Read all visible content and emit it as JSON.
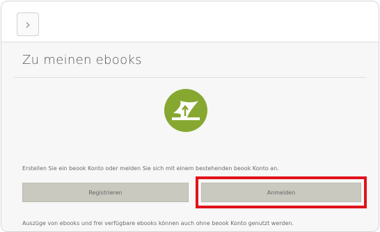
{
  "nav": {
    "back_icon": "chevron-right-icon",
    "back_glyph": "›"
  },
  "page": {
    "title": "Zu meinen ebooks",
    "logo_icon": "road-arrow-icon",
    "intro_text": "Erstellen Sie ein beook Konto oder melden Sie sich mit einem bestehenden beook Konto an.",
    "footer_text": "Auszüge von ebooks und frei verfügbare ebooks können auch ohne beook Konto genutzt werden."
  },
  "buttons": {
    "register_label": "Registrieren",
    "login_label": "Anmelden"
  },
  "colors": {
    "logo_green": "#86a830",
    "highlight_red": "#e0131c",
    "button_gray": "#c9c9c0"
  }
}
